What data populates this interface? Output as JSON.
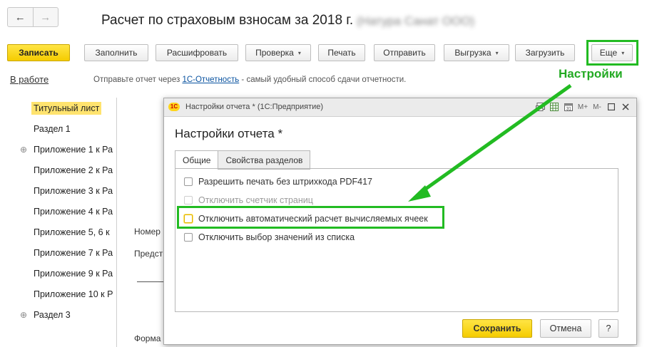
{
  "nav": {
    "back_icon": "←",
    "forward_icon": "→"
  },
  "header": {
    "title": "Расчет по страховым взносам за 2018 г.",
    "org": "(Натура Санат ООО)"
  },
  "toolbar": {
    "save": "Записать",
    "fill": "Заполнить",
    "decode": "Расшифровать",
    "check": "Проверка",
    "print": "Печать",
    "send": "Отправить",
    "export": "Выгрузка",
    "load": "Загрузить",
    "more": "Еще",
    "dropdown_icon": "▾"
  },
  "status": {
    "label": "В работе",
    "hint_prefix": "Отправьте отчет через ",
    "hint_link": "1С-Отчетность",
    "hint_suffix": " - самый удобный способ сдачи отчетности."
  },
  "annotation": {
    "settings_label": "Настройки",
    "highlight_color": "#22bb22"
  },
  "tree": {
    "items": [
      {
        "label": "Титульный лист"
      },
      {
        "label": "Раздел 1"
      },
      {
        "label": "Приложение 1 к Ра"
      },
      {
        "label": "Приложение 2 к Ра"
      },
      {
        "label": "Приложение 3 к Ра"
      },
      {
        "label": "Приложение 4 к Ра"
      },
      {
        "label": "Приложение 5, 6 к"
      },
      {
        "label": "Приложение 7 к Ра"
      },
      {
        "label": "Приложение 9 к Ра"
      },
      {
        "label": "Приложение 10 к Р"
      },
      {
        "label": "Раздел 3"
      }
    ]
  },
  "doc": {
    "line1": "Номер",
    "line2": "Предст",
    "line3": "Форма"
  },
  "modal": {
    "window_title": "Настройки отчета * (1С:Предприятие)",
    "logo_text": "1С",
    "heading": "Настройки отчета *",
    "tabs": [
      "Общие",
      "Свойства разделов"
    ],
    "options": [
      {
        "label": "Разрешить печать без штрихкода PDF417",
        "disabled": false
      },
      {
        "label": "Отключить счетчик страниц",
        "disabled": true
      },
      {
        "label": "Отключить автоматический расчет вычисляемых ячеек",
        "disabled": false
      },
      {
        "label": "Отключить выбор значений из списка",
        "disabled": false
      }
    ],
    "save_button": "Сохранить",
    "cancel_button": "Отмена",
    "help_button": "?",
    "icons": {
      "m_plus": "M+",
      "m_minus": "M-"
    }
  },
  "colors": {
    "accent_yellow": "#f5cc00",
    "link": "#0a53a0",
    "highlight_green": "#22bb22"
  }
}
